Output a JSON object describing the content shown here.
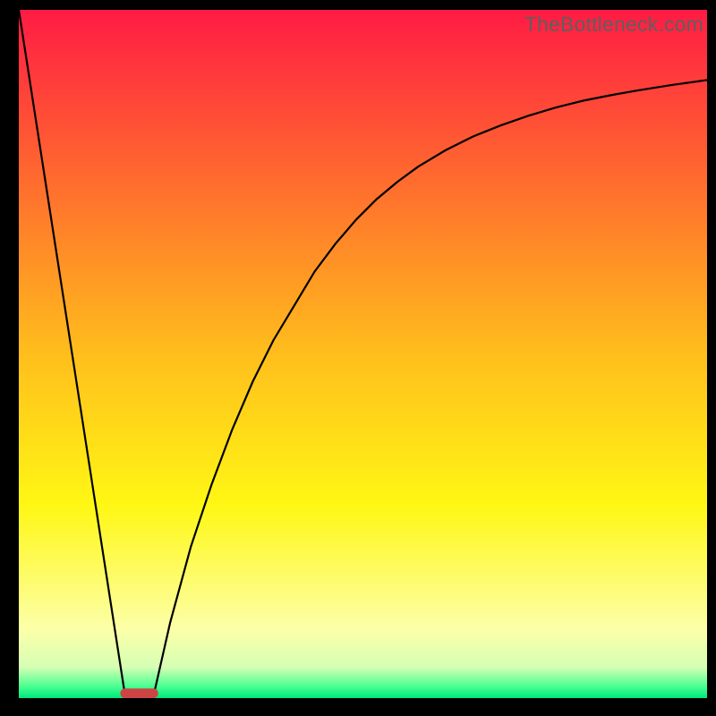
{
  "watermark": "TheBottleneck.com",
  "chart_data": {
    "type": "line",
    "title": "",
    "xlabel": "",
    "ylabel": "",
    "xlim": [
      0,
      100
    ],
    "ylim": [
      0,
      100
    ],
    "grid": false,
    "legend": false,
    "background_gradient_stops": [
      {
        "offset": 0.0,
        "color": "#ff1b44"
      },
      {
        "offset": 0.25,
        "color": "#ff6c2e"
      },
      {
        "offset": 0.5,
        "color": "#ffbe1c"
      },
      {
        "offset": 0.72,
        "color": "#fff714"
      },
      {
        "offset": 0.9,
        "color": "#fcffa8"
      },
      {
        "offset": 0.955,
        "color": "#d6ffb4"
      },
      {
        "offset": 0.985,
        "color": "#40ff8f"
      },
      {
        "offset": 1.0,
        "color": "#00e67a"
      }
    ],
    "series": [
      {
        "name": "left-segment",
        "kind": "line",
        "x": [
          0,
          15.5
        ],
        "y": [
          100,
          0
        ]
      },
      {
        "name": "right-curve",
        "kind": "line",
        "x": [
          19.5,
          22,
          25,
          28,
          31,
          34,
          37,
          40,
          43,
          46,
          49,
          52,
          55,
          58,
          62,
          66,
          70,
          74,
          78,
          82,
          86,
          90,
          95,
          100
        ],
        "y": [
          0,
          11,
          22,
          31,
          39,
          46,
          52,
          57,
          62,
          66,
          69.5,
          72.5,
          75,
          77.2,
          79.6,
          81.6,
          83.2,
          84.6,
          85.8,
          86.8,
          87.6,
          88.3,
          89.1,
          89.8
        ]
      }
    ],
    "marker": {
      "name": "bottom-pill",
      "x_center": 17.5,
      "width": 5.5,
      "height_frac": 0.014,
      "color": "#cc4444"
    }
  }
}
